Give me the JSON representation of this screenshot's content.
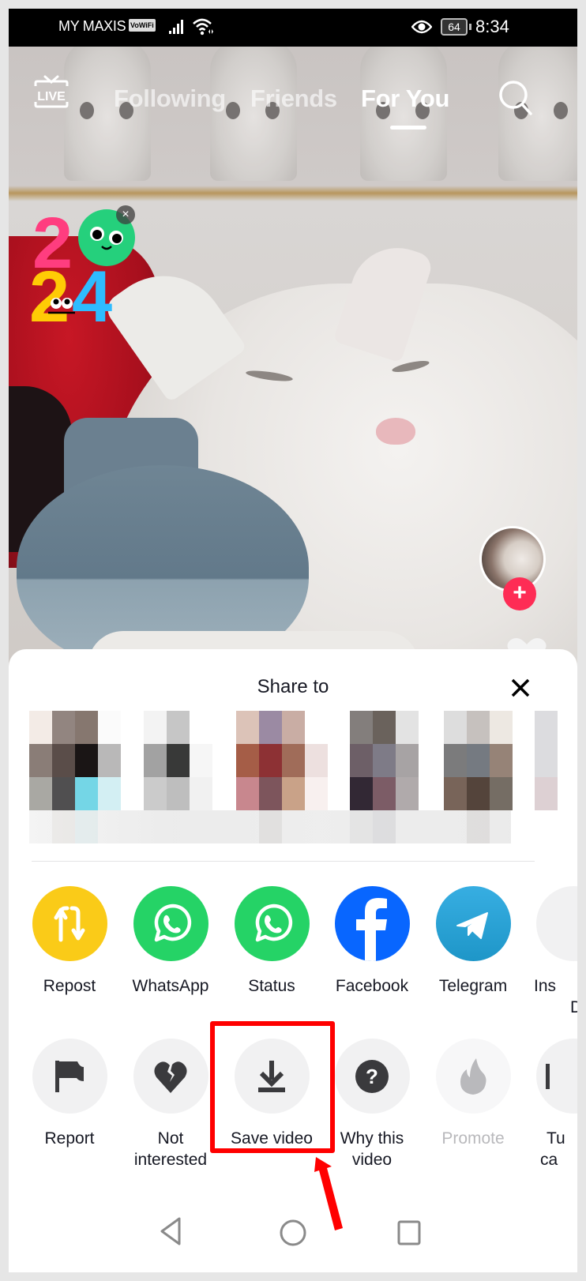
{
  "status_bar": {
    "carrier": "MY MAXIS",
    "vowifi_badge": "VoWiFi",
    "battery_level": "64",
    "time": "8:34"
  },
  "top_nav": {
    "live_label": "LIVE",
    "tabs": [
      {
        "label": "Following",
        "active": false
      },
      {
        "label": "Friends",
        "active": false
      },
      {
        "label": "For You",
        "active": true
      }
    ]
  },
  "video": {
    "sticker_text": "2024",
    "sticker_close": "×",
    "follow_symbol": "+"
  },
  "share_sheet": {
    "title": "Share to",
    "close_symbol": "✕",
    "share_apps": [
      {
        "label": "Repost",
        "icon": "repost-icon",
        "color": "#facb18"
      },
      {
        "label": "WhatsApp",
        "icon": "whatsapp-icon",
        "color": "#25d366"
      },
      {
        "label": "Status",
        "icon": "whatsapp-icon",
        "color": "#25d366"
      },
      {
        "label": "Facebook",
        "icon": "facebook-icon",
        "color": "#0866ff"
      },
      {
        "label": "Telegram",
        "icon": "telegram-icon",
        "color": "#2aa3dd"
      },
      {
        "label": "Ins",
        "label_line2": "D",
        "icon": "instagram-direct-icon",
        "color": "#f1f1f2"
      }
    ],
    "actions": [
      {
        "label": "Report",
        "icon": "flag-icon",
        "enabled": true
      },
      {
        "label": "Not",
        "label_line2": "interested",
        "icon": "broken-heart-icon",
        "enabled": true
      },
      {
        "label": "Save video",
        "icon": "download-icon",
        "enabled": true,
        "highlighted": true
      },
      {
        "label": "Why this",
        "label_line2": "video",
        "icon": "question-icon",
        "enabled": true
      },
      {
        "label": "Promote",
        "icon": "flame-icon",
        "enabled": false
      },
      {
        "label": "Tu",
        "label_line2": "ca",
        "icon": "captions-icon",
        "enabled": true
      }
    ]
  },
  "colors": {
    "accent_red": "#fe2c55",
    "annotation_red": "#ff0000",
    "text_primary": "#161823",
    "text_disabled": "#b9b9bc"
  }
}
